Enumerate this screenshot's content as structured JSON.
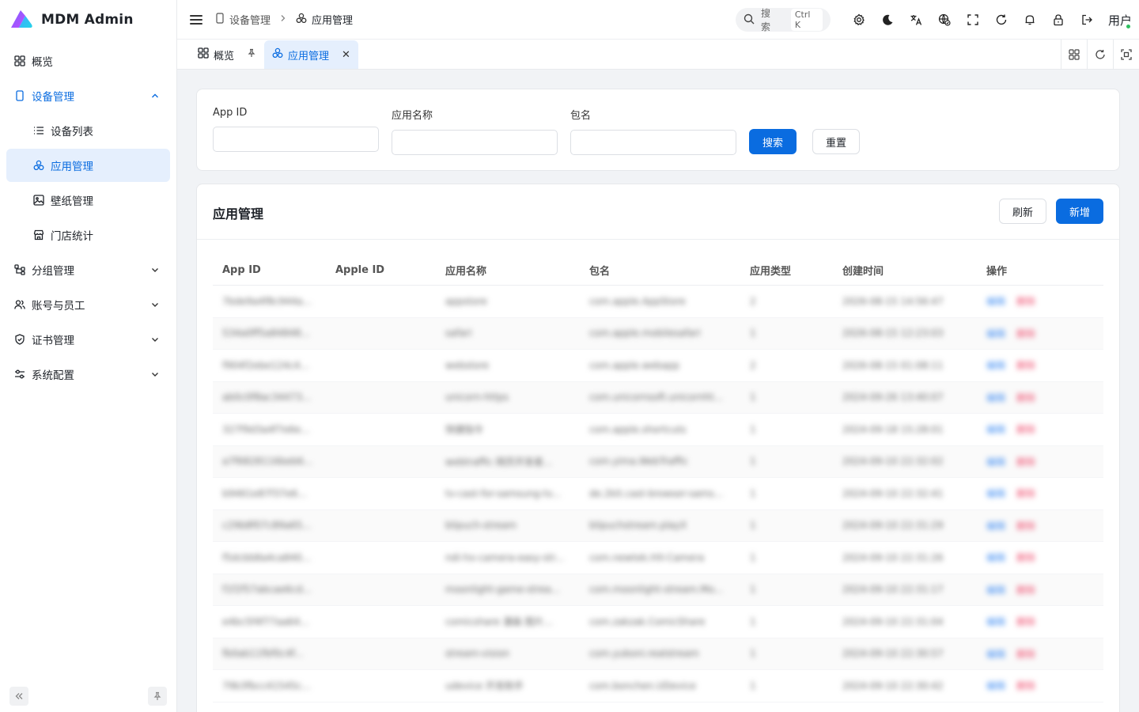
{
  "app": {
    "title": "MDM Admin"
  },
  "sidebar": {
    "items": [
      {
        "label": "概览"
      },
      {
        "label": "设备管理"
      },
      {
        "label": "设备列表"
      },
      {
        "label": "应用管理"
      },
      {
        "label": "壁纸管理"
      },
      {
        "label": "门店统计"
      },
      {
        "label": "分组管理"
      },
      {
        "label": "账号与员工"
      },
      {
        "label": "证书管理"
      },
      {
        "label": "系统配置"
      }
    ]
  },
  "header": {
    "breadcrumb": [
      "设备管理",
      "应用管理"
    ],
    "search_label": "搜索",
    "search_shortcut": "Ctrl K",
    "user_label": "用户"
  },
  "tabs": [
    {
      "label": "概览"
    },
    {
      "label": "应用管理"
    }
  ],
  "filter": {
    "fields": [
      {
        "label": "App ID",
        "value": ""
      },
      {
        "label": "应用名称",
        "value": ""
      },
      {
        "label": "包名",
        "value": ""
      }
    ],
    "search_button": "搜索",
    "reset_button": "重置"
  },
  "table": {
    "title": "应用管理",
    "refresh_button": "刷新",
    "add_button": "新增",
    "columns": [
      "App ID",
      "Apple ID",
      "应用名称",
      "包名",
      "应用类型",
      "创建时间",
      "操作"
    ],
    "rows": [
      {
        "app_id": "7bde9a4f8c944a...",
        "apple_id": "",
        "name": "appstore",
        "pkg": "com.apple.AppStore",
        "type": "2",
        "created": "2026-08-15 14:56:47",
        "edit": "编辑",
        "del": "删除"
      },
      {
        "app_id": "534a0ff5a84848...",
        "apple_id": "",
        "name": "safari",
        "pkg": "com.apple.mobilesafari",
        "type": "1",
        "created": "2026-08-15 12:23:03",
        "edit": "编辑",
        "del": "删除"
      },
      {
        "app_id": "f904f2ebe124c4...",
        "apple_id": "",
        "name": "webstore",
        "pkg": "com.apple.webapp",
        "type": "2",
        "created": "2026-08-15 01:08:11",
        "edit": "编辑",
        "del": "删除"
      },
      {
        "app_id": "ab0c0f8ac34473...",
        "apple_id": "",
        "name": "unicorn-https",
        "pkg": "com.unicornsoft.unicornht...",
        "type": "1",
        "created": "2024-09-26 13:40:07",
        "edit": "编辑",
        "del": "删除"
      },
      {
        "app_id": "327f9d3a4f7e6e...",
        "apple_id": "",
        "name": "快捷指令",
        "pkg": "com.apple.shortcuts",
        "type": "1",
        "created": "2024-09-18 15:28:01",
        "edit": "编辑",
        "del": "删除"
      },
      {
        "app_id": "a7f6828116beb6...",
        "apple_id": "",
        "name": "webtraffic 网页开发者...",
        "pkg": "com.yima.WebTraffic",
        "type": "1",
        "created": "2024-09-10 22:32:02",
        "edit": "编辑",
        "del": "删除"
      },
      {
        "app_id": "b9461e87f37e6...",
        "apple_id": "",
        "name": "tv-cast-for-samsung-tv...",
        "pkg": "de.2kit.cast-browser-sams...",
        "type": "1",
        "created": "2024-09-10 22:32:41",
        "edit": "编辑",
        "del": "删除"
      },
      {
        "app_id": "c29b8f07c89a65...",
        "apple_id": "",
        "name": "blipuch-stream",
        "pkg": "blipuchstream.playX",
        "type": "1",
        "created": "2024-09-10 22:31:29",
        "edit": "编辑",
        "del": "删除"
      },
      {
        "app_id": "f5dcbb8a4ca840...",
        "apple_id": "",
        "name": "ndi-hx-camera-easy-str...",
        "pkg": "com.newtek.HX-Camera",
        "type": "1",
        "created": "2024-09-10 22:31:26",
        "edit": "编辑",
        "del": "删除"
      },
      {
        "app_id": "f1f2f57abcae6cd...",
        "apple_id": "",
        "name": "moonlight-game-strea...",
        "pkg": "com.moonlight-stream.Mo...",
        "type": "1",
        "created": "2024-09-10 22:31:17",
        "edit": "编辑",
        "del": "删除"
      },
      {
        "app_id": "e4bc5f4f77aa64...",
        "apple_id": "",
        "name": "comicshare 漫画 图片...",
        "pkg": "com.zakzak.ComicShare",
        "type": "1",
        "created": "2024-09-10 22:31:04",
        "edit": "编辑",
        "del": "删除"
      },
      {
        "app_id": "fb0ab11fbf0c4f...",
        "apple_id": "",
        "name": "stream-vision",
        "pkg": "com.yuboni.realstream",
        "type": "1",
        "created": "2024-09-10 22:30:57",
        "edit": "编辑",
        "del": "删除"
      },
      {
        "app_id": "79b3fbcc41545c...",
        "apple_id": "",
        "name": "udevice 开发助手",
        "pkg": "com.bonchen.UDevice",
        "type": "1",
        "created": "2024-09-10 22:30:42",
        "edit": "编辑",
        "del": "删除"
      }
    ]
  },
  "colors": {
    "primary": "#0a6ce0",
    "active_bg": "#e5effd",
    "danger": "#ef4b6c",
    "page_bg": "#f1f3f6"
  }
}
